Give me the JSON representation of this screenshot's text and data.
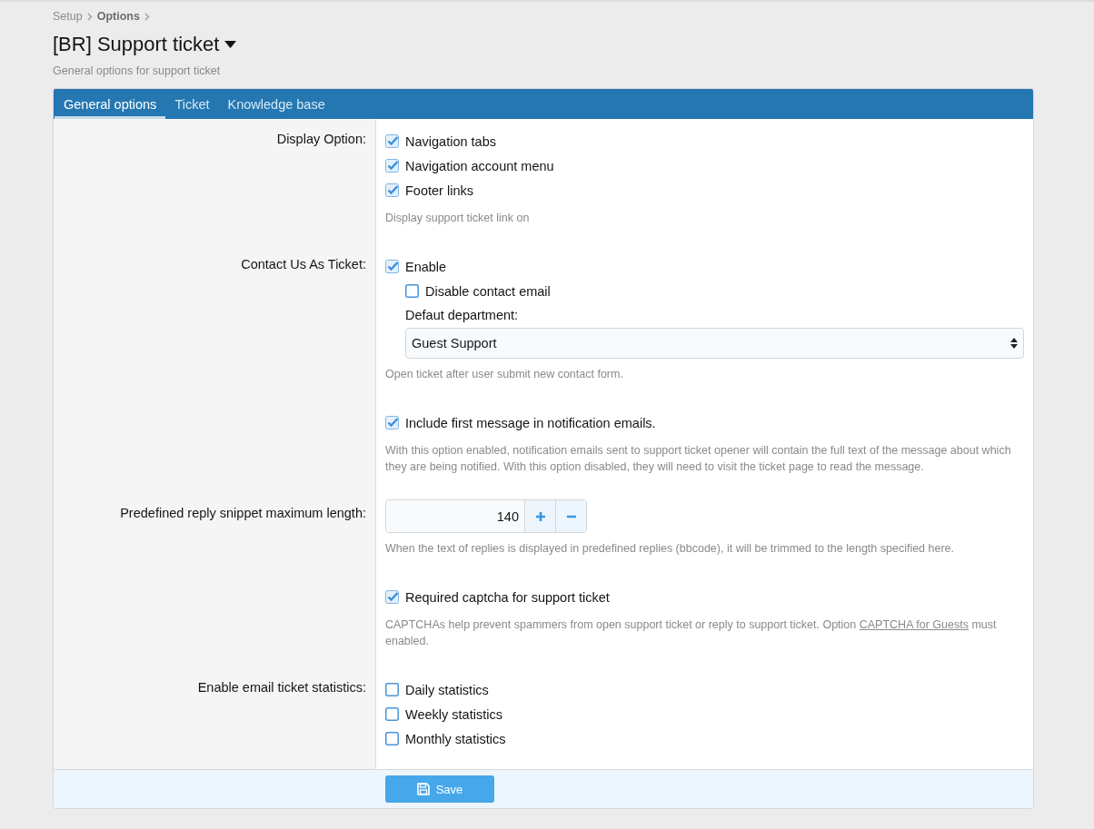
{
  "breadcrumb": [
    {
      "label": "Setup",
      "bold": false
    },
    {
      "label": "Options",
      "bold": true
    }
  ],
  "title": "[BR] Support ticket",
  "description": "General options for support ticket",
  "tabs": [
    {
      "label": "General options",
      "selected": true
    },
    {
      "label": "Ticket",
      "selected": false
    },
    {
      "label": "Knowledge base",
      "selected": false
    }
  ],
  "rows": [
    {
      "label": "Display Option:",
      "controls": [
        {
          "kind": "checkbox",
          "label": "Navigation tabs",
          "checked": true
        },
        {
          "kind": "checkbox",
          "label": "Navigation account menu",
          "checked": true
        },
        {
          "kind": "checkbox",
          "label": "Footer links",
          "checked": true
        },
        {
          "kind": "hint",
          "text": "Display support ticket link on"
        }
      ]
    },
    {
      "label": "Contact Us As Ticket:",
      "controls": [
        {
          "kind": "checkbox",
          "label": "Enable",
          "checked": true,
          "children": [
            {
              "kind": "checkbox",
              "label": "Disable contact email",
              "checked": false
            },
            {
              "kind": "select",
              "label": "Defaut department:",
              "value": "Guest Support"
            }
          ]
        },
        {
          "kind": "hint",
          "text": "Open ticket after user submit new contact form."
        }
      ]
    },
    {
      "controls": [
        {
          "kind": "checkbox",
          "label": "Include first message in notification emails.",
          "checked": true
        },
        {
          "kind": "hint",
          "text": "With this option enabled, notification emails sent to support ticket opener will contain the full text of the message about which they are being notified. With this option disabled, they will need to visit the ticket page to read the message."
        }
      ]
    },
    {
      "label": "Predefined reply snippet maximum length:",
      "controls": [
        {
          "kind": "number",
          "value": "140"
        },
        {
          "kind": "hint",
          "text": "When the text of replies is displayed in predefined replies (bbcode), it will be trimmed to the length specified here."
        }
      ]
    },
    {
      "controls": [
        {
          "kind": "checkbox",
          "label": "Required captcha for support ticket",
          "checked": true
        },
        {
          "kind": "hint",
          "text": "CAPTCHAs help prevent spammers from open support ticket or reply to support ticket. Option ",
          "link": "CAPTCHA for Guests",
          "after": " must enabled."
        }
      ]
    },
    {
      "label": "Enable email ticket statistics:",
      "controls": [
        {
          "kind": "checkbox",
          "label": "Daily statistics",
          "checked": false
        },
        {
          "kind": "checkbox",
          "label": "Weekly statistics",
          "checked": false
        },
        {
          "kind": "checkbox",
          "label": "Monthly statistics",
          "checked": false
        }
      ]
    }
  ],
  "save_button": "Save"
}
